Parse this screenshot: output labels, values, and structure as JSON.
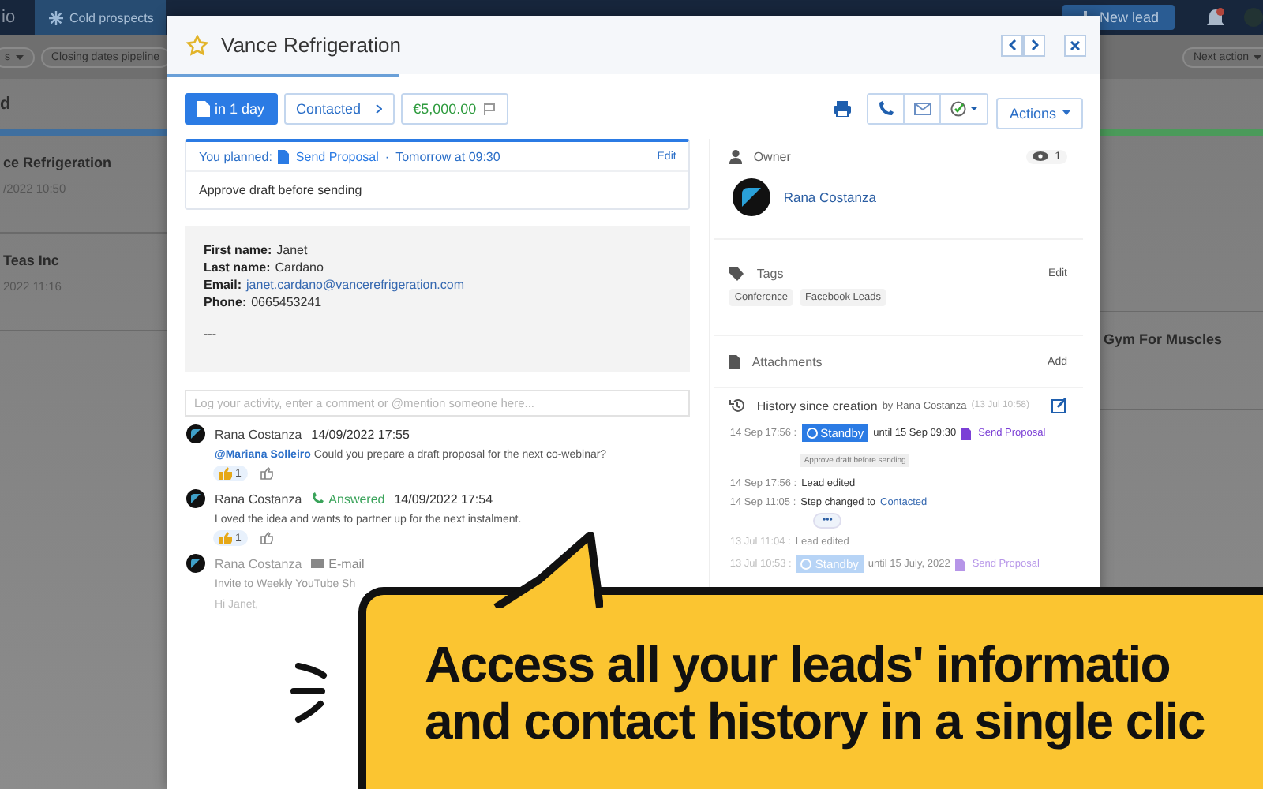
{
  "background_app": {
    "brand": "io",
    "tab": "Cold prospects",
    "new_lead": "New lead",
    "filters": [
      {
        "label": "s",
        "dropdown": true
      },
      {
        "label": "Closing dates pipeline",
        "dropdown": false
      }
    ],
    "right_filters": [
      {
        "label": "Next action",
        "dropdown": true
      }
    ],
    "left_column": {
      "heading": "d",
      "cards": [
        {
          "title": "ce Refrigeration",
          "date": "/2022 10:50"
        },
        {
          "title": " Teas Inc",
          "date": "2022 11:16"
        }
      ]
    },
    "right_column": {
      "cards": [
        {
          "title": "Gym For Muscles"
        }
      ]
    }
  },
  "lead": {
    "title": "Vance Refrigeration",
    "starred": false,
    "due": "in 1 day",
    "stage": "Contacted",
    "amount": "€5,000.00",
    "actions": "Actions",
    "planned": {
      "label": "You planned:",
      "task": "Send Proposal",
      "separator": "·",
      "when": "Tomorrow at 09:30",
      "edit": "Edit",
      "note": "Approve draft before sending"
    },
    "contact": {
      "fields": [
        {
          "label": "First name:",
          "value": "Janet",
          "kind": "text"
        },
        {
          "label": "Last name:",
          "value": "Cardano",
          "kind": "text"
        },
        {
          "label": "Email:",
          "value": "janet.cardano@vancerefrigeration.com",
          "kind": "link"
        },
        {
          "label": "Phone:",
          "value": "0665453241",
          "kind": "text"
        }
      ],
      "footer": "---"
    },
    "comment_field": {
      "placeholder": "Log your activity, enter a comment or @mention someone here..."
    },
    "activities": [
      {
        "kind": "comment",
        "author": "Rana Costanza",
        "date": "14/09/2022 17:55",
        "mention": "@Mariana Solleiro",
        "text": "Could you prepare a draft proposal for the next co-webinar?",
        "reaction": "1"
      },
      {
        "kind": "call",
        "author": "Rana Costanza",
        "status": "Answered",
        "date": "14/09/2022 17:54",
        "text": "Loved the idea and wants to partner up for the next instalment.",
        "reaction": "1"
      },
      {
        "kind": "email",
        "author": "Rana Costanza",
        "status": "E-mail",
        "text": "Invite to Weekly YouTube Sh",
        "body": "Hi Janet,"
      }
    ],
    "owner": {
      "label": "Owner",
      "views": "1",
      "name": "Rana Costanza"
    },
    "tags": {
      "label": "Tags",
      "edit": "Edit",
      "items": [
        "Conference",
        "Facebook Leads"
      ]
    },
    "attachments": {
      "label": "Attachments",
      "add": "Add"
    },
    "history": {
      "title": "History since creation",
      "by": "by Rana Costanza",
      "date": "(13 Jul 10:58)",
      "entries": [
        {
          "kind": "standby",
          "faded": false,
          "time": "14 Sep 17:56 :",
          "badge": "Standby",
          "text": "until 15 Sep 09:30",
          "task": "Send Proposal",
          "note": "Approve draft before sending"
        },
        {
          "kind": "plain",
          "faded": false,
          "time": "14 Sep 17:56 :",
          "text": "Lead edited"
        },
        {
          "kind": "step",
          "faded": false,
          "time": "14 Sep 11:05 :",
          "text": "Step changed to",
          "link": "Contacted"
        },
        {
          "kind": "more",
          "label": "•••"
        },
        {
          "kind": "plain",
          "faded": true,
          "time": "13 Jul 11:04 :",
          "text": "Lead edited"
        },
        {
          "kind": "standby",
          "faded": true,
          "time": "13 Jul 10:53 :",
          "badge": "Standby",
          "text": "until 15 July, 2022",
          "task": "Send Proposal"
        }
      ]
    }
  },
  "callout": {
    "lines": [
      "Access all your leads' informatio",
      "and contact history in a single clic"
    ]
  }
}
